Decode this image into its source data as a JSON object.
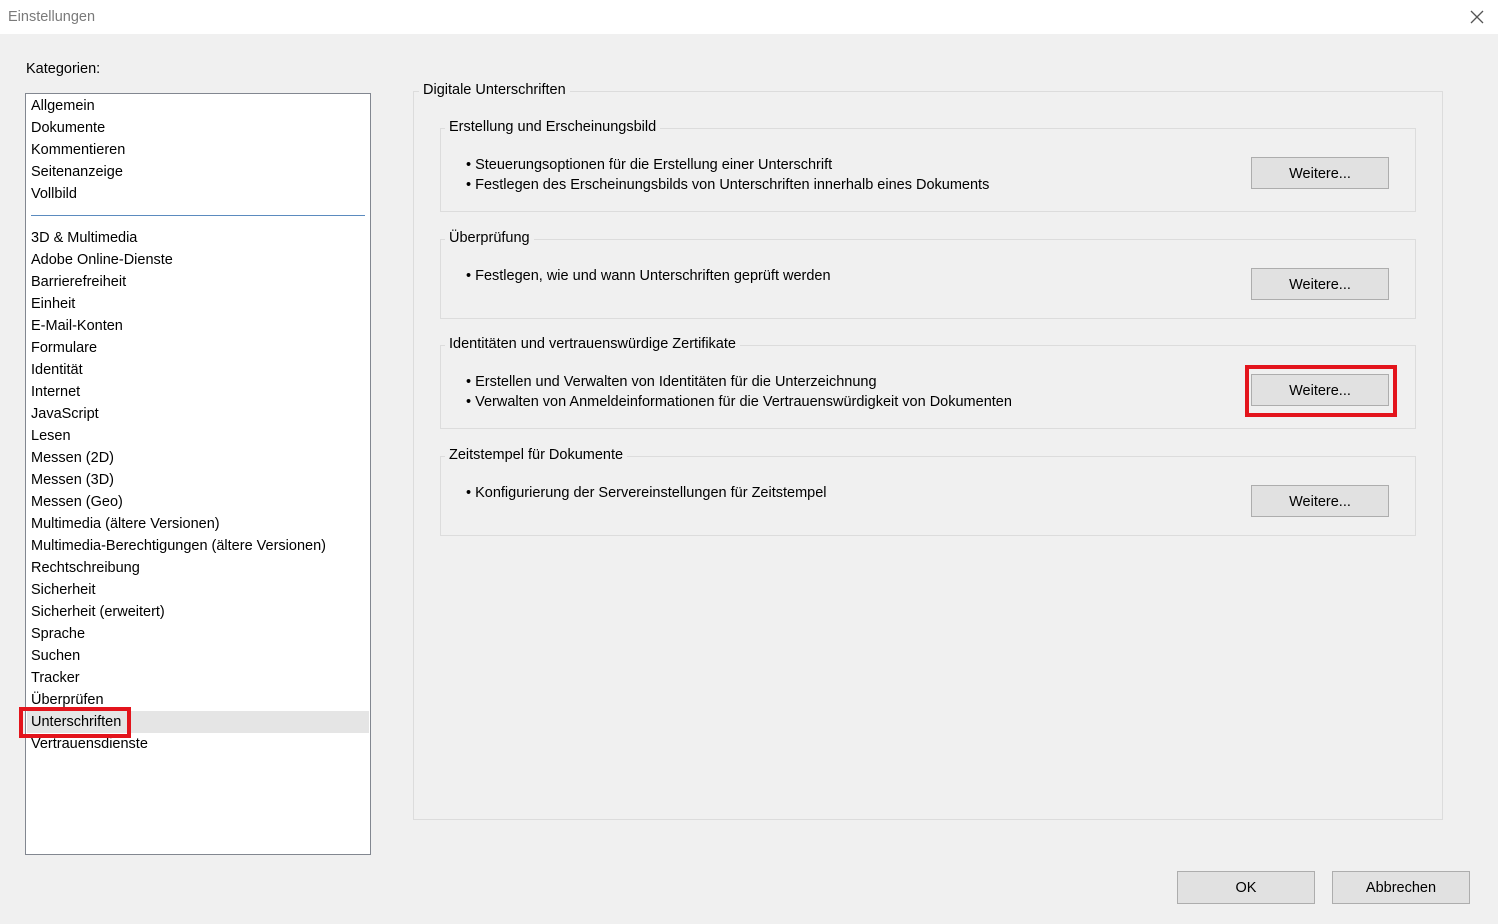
{
  "window": {
    "title": "Einstellungen",
    "close_icon": "close-icon"
  },
  "categories": {
    "label": "Kategorien:",
    "group1": [
      "Allgemein",
      "Dokumente",
      "Kommentieren",
      "Seitenanzeige",
      "Vollbild"
    ],
    "group2": [
      "3D & Multimedia",
      "Adobe Online-Dienste",
      "Barrierefreiheit",
      "Einheit",
      "E-Mail-Konten",
      "Formulare",
      "Identität",
      "Internet",
      "JavaScript",
      "Lesen",
      "Messen (2D)",
      "Messen (3D)",
      "Messen (Geo)",
      "Multimedia (ältere Versionen)",
      "Multimedia-Berechtigungen (ältere Versionen)",
      "Rechtschreibung",
      "Sicherheit",
      "Sicherheit (erweitert)",
      "Sprache",
      "Suchen",
      "Tracker",
      "Überprüfen",
      "Unterschriften",
      "Vertrauensdienste"
    ],
    "selected": "Unterschriften"
  },
  "main": {
    "title": "Digitale Unterschriften",
    "sections": [
      {
        "title": "Erstellung und Erscheinungsbild",
        "bullets": [
          "• Steuerungsoptionen für die Erstellung einer Unterschrift",
          "• Festlegen des Erscheinungsbilds von Unterschriften innerhalb eines Dokuments"
        ],
        "button": "Weitere..."
      },
      {
        "title": "Überprüfung",
        "bullets": [
          "• Festlegen, wie und wann Unterschriften geprüft werden"
        ],
        "button": "Weitere..."
      },
      {
        "title": "Identitäten und vertrauenswürdige Zertifikate",
        "bullets": [
          "• Erstellen und Verwalten von Identitäten für die Unterzeichnung",
          "• Verwalten von Anmeldeinformationen für die Vertrauenswürdigkeit von Dokumenten"
        ],
        "button": "Weitere..."
      },
      {
        "title": "Zeitstempel für Dokumente",
        "bullets": [
          "• Konfigurierung der Servereinstellungen für Zeitstempel"
        ],
        "button": "Weitere..."
      }
    ]
  },
  "footer": {
    "ok": "OK",
    "cancel": "Abbrechen"
  },
  "colors": {
    "highlight": "#e3141c",
    "separator": "#5b8bbf",
    "background": "#f0f0f0"
  }
}
